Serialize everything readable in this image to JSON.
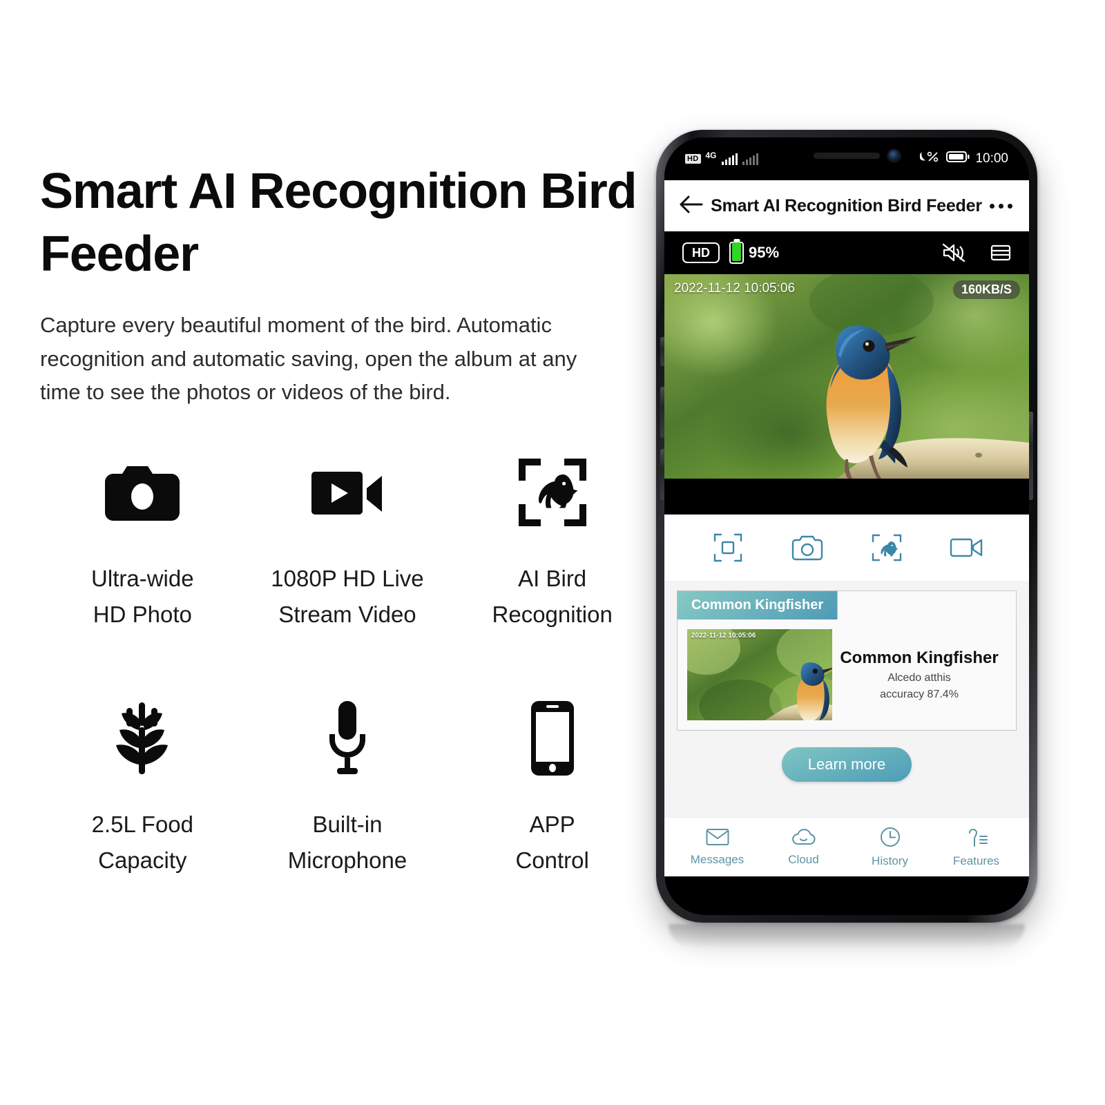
{
  "hero": {
    "headline": "Smart AI Recognition Bird Feeder",
    "subcopy": "Capture every beautiful moment of the bird. Automatic recognition and automatic saving, open the album at any time to see the photos or videos of the bird."
  },
  "features": [
    {
      "icon": "camera-icon",
      "label": "Ultra-wide\nHD Photo"
    },
    {
      "icon": "video-play-icon",
      "label": "1080P HD Live\nStream Video"
    },
    {
      "icon": "bird-scan-icon",
      "label": "AI Bird\nRecognition"
    },
    {
      "icon": "grain-icon",
      "label": "2.5L Food\nCapacity"
    },
    {
      "icon": "microphone-icon",
      "label": "Built-in\nMicrophone"
    },
    {
      "icon": "smartphone-icon",
      "label": "APP\nControl"
    }
  ],
  "phone": {
    "status_bar": {
      "hd_badge": "HD",
      "network": "4G",
      "battery_icon": "battery-icon",
      "time": "10:00"
    },
    "app_header": {
      "back_icon": "back-arrow-icon",
      "title": "Smart AI Recognition Bird Feeder",
      "menu_icon": "more-options-icon"
    },
    "video_toolbar": {
      "quality_badge": "HD",
      "battery_percent": "95%",
      "battery_level": 95,
      "mute_icon": "speaker-muted-icon",
      "layout_icon": "split-view-icon"
    },
    "video": {
      "timestamp": "2022-11-12 10:05:06",
      "bitrate": "160KB/S"
    },
    "actions": [
      {
        "icon": "fullscreen-icon",
        "name": "fullscreen"
      },
      {
        "icon": "camera-icon",
        "name": "snapshot"
      },
      {
        "icon": "bird-scan-icon",
        "name": "bird-recognition"
      },
      {
        "icon": "video-icon",
        "name": "record"
      }
    ],
    "result": {
      "tab_label": "Common Kingfisher",
      "thumb_timestamp": "2022-11-12 10:05:06",
      "species_name": "Common Kingfisher",
      "species_latin": "Alcedo atthis",
      "accuracy": "accuracy 87.4%",
      "learn_more_label": "Learn more"
    },
    "bottom_nav": [
      {
        "icon": "mail-icon",
        "label": "Messages"
      },
      {
        "icon": "cloud-icon",
        "label": "Cloud"
      },
      {
        "icon": "clock-icon",
        "label": "History"
      },
      {
        "icon": "features-icon",
        "label": "Features"
      }
    ]
  },
  "colors": {
    "accent_teal": "#5e93a5",
    "tab_gradient_start": "#86c9c4",
    "tab_gradient_end": "#4f9bb6",
    "battery_green": "#2fd624",
    "text_primary": "#111111"
  }
}
